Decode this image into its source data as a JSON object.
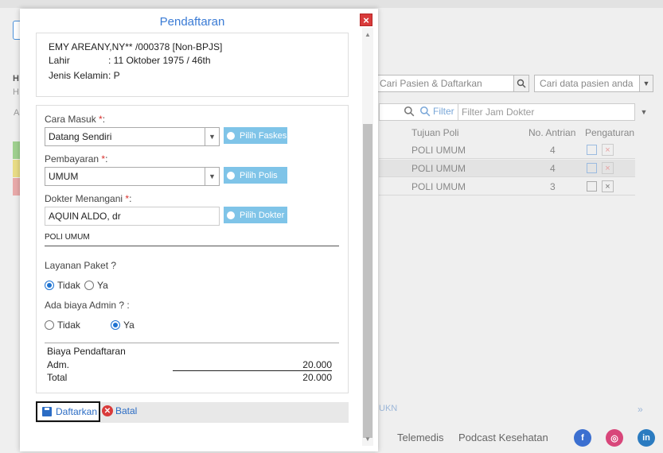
{
  "modal": {
    "title": "Pendaftaran",
    "patient": {
      "name_line": "EMY AREANY,NY** /000378 [Non-BPJS]",
      "birth_label": "Lahir",
      "birth_value": ": 11 Oktober 1975 / 46th",
      "gender_label": "Jenis Kelamin",
      "gender_value": ": P"
    },
    "form": {
      "cara_masuk_label": "Cara Masuk",
      "cara_masuk_value": "Datang Sendiri",
      "pilih_faskes": "Pilih Faskes",
      "pembayaran_label": "Pembayaran",
      "pembayaran_value": "UMUM",
      "pilih_polis": "Pilih Polis",
      "dokter_label": "Dokter Menangani",
      "dokter_value": "AQUIN ALDO, dr",
      "pilih_dokter": "Pilih Dokter",
      "poli": "POLI UMUM",
      "required_mark": "*",
      "colon": ":",
      "layanan_paket_label": "Layanan Paket ?",
      "layanan_paket_options": [
        "Tidak",
        "Ya"
      ],
      "biaya_admin_label": "Ada biaya Admin ? :",
      "biaya_admin_options": [
        "Tidak",
        "Ya"
      ]
    },
    "fees": {
      "title": "Biaya Pendaftaran",
      "adm_label": "Adm.",
      "adm_value": "20.000",
      "total_label": "Total",
      "total_value": "20.000"
    },
    "buttons": {
      "daftarkan": "Daftarkan",
      "batal": "Batal",
      "close": "×"
    }
  },
  "background": {
    "search_placeholder_1": "Cari Pasien & Daftarkan",
    "search_placeholder_2": "Cari data pasien anda",
    "filter_label": "Filter",
    "filter_placeholder": "Filter Jam Dokter",
    "table_headers": [
      "Tujuan Poli",
      "No. Antrian",
      "Pengaturan"
    ],
    "rows": [
      {
        "poli": "POLI UMUM",
        "antrian": "4"
      },
      {
        "poli": "POLI UMUM",
        "antrian": "4"
      },
      {
        "poli": "POLI UMUM",
        "antrian": "3"
      }
    ],
    "footer_links": [
      "Telemedis",
      "Podcast Kesehatan"
    ],
    "ukn_text": "UKN",
    "pager_next": "»",
    "left_letters": [
      "H",
      "H",
      "A"
    ]
  },
  "colors": {
    "accent": "#3a7bd5",
    "pick_button": "#7fc4e8",
    "danger": "#d93b3b"
  }
}
